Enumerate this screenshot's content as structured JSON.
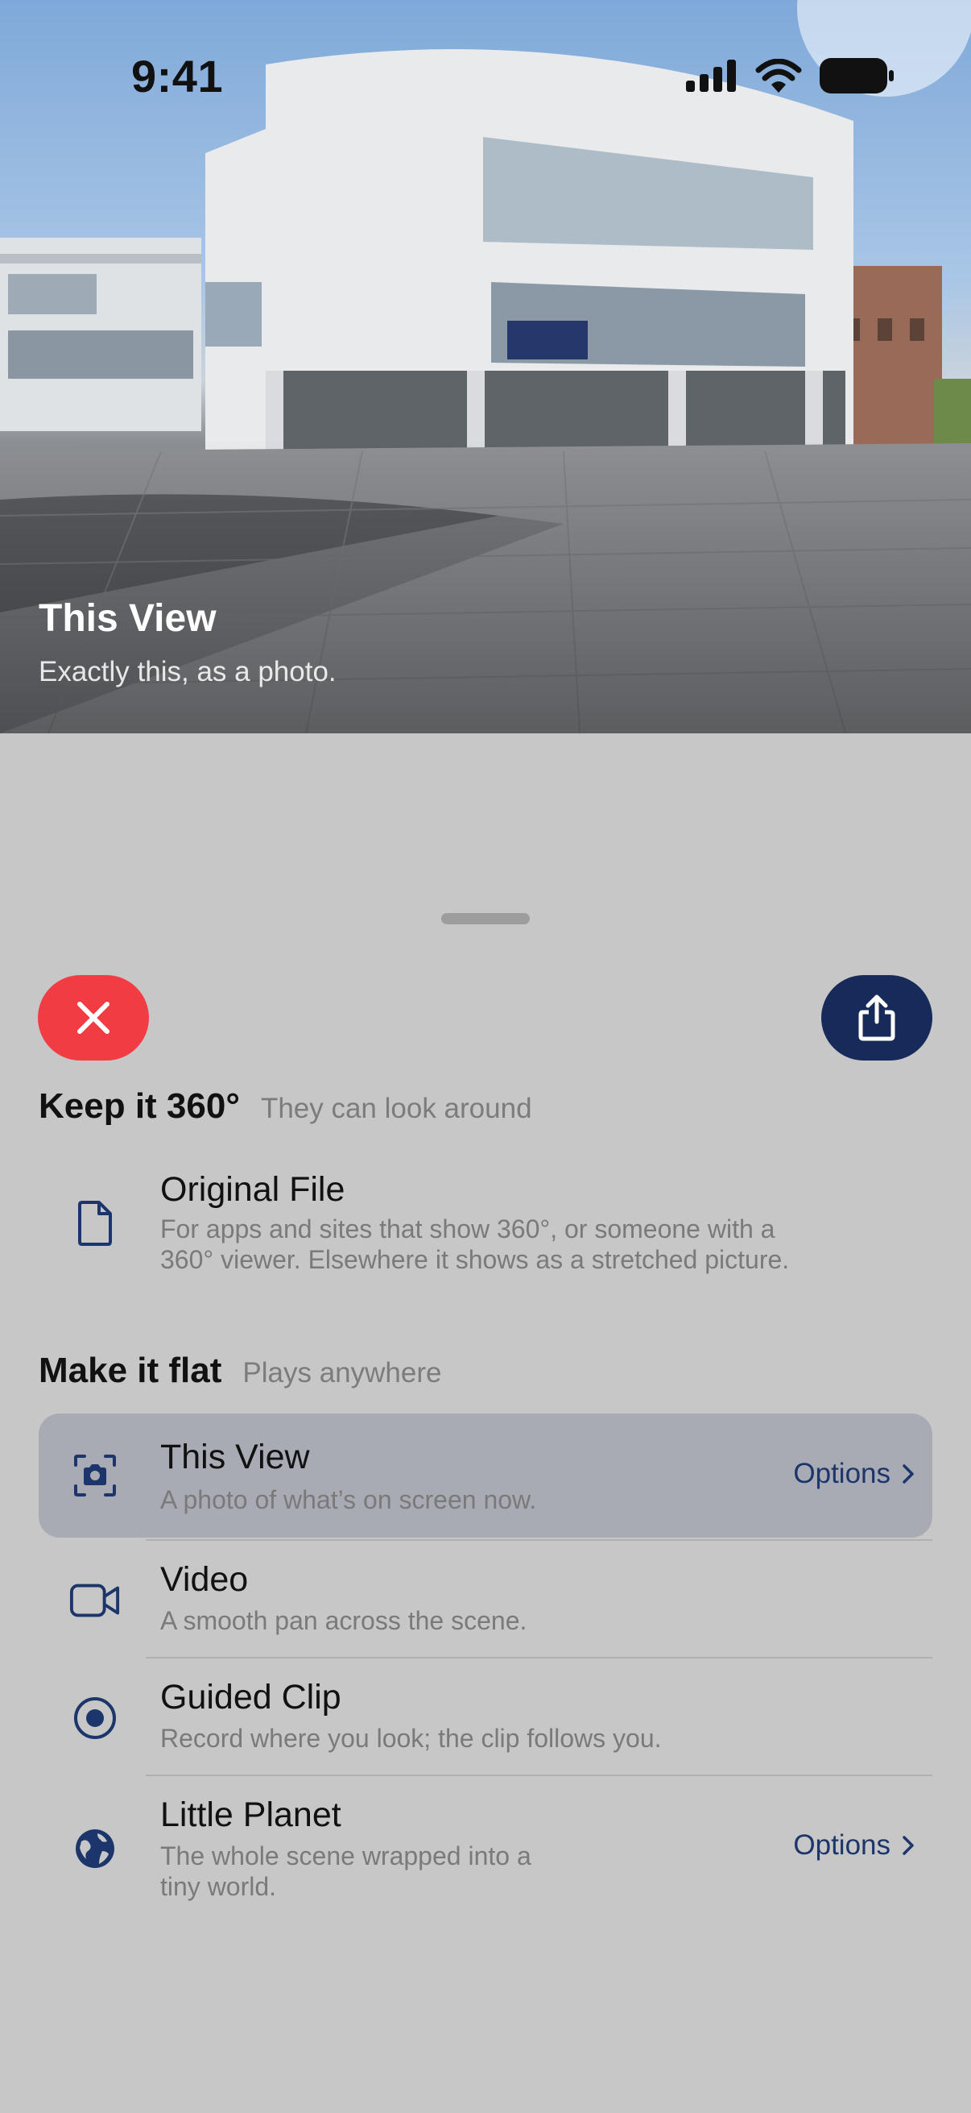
{
  "status_bar": {
    "time": "9:41",
    "icons": [
      "cellular-signal-icon",
      "wifi-icon",
      "battery-icon"
    ]
  },
  "hero": {
    "title": "This View",
    "subtitle": "Exactly this, as a photo."
  },
  "actions": {
    "close_icon": "close-icon",
    "share_icon": "share-icon"
  },
  "colors": {
    "close": "#f23c43",
    "share": "#162b5a",
    "accent": "#1c356a",
    "selected_row": "#a8abb4",
    "sheet": "#c7c7c7"
  },
  "keep_section": {
    "title": "Keep it 360°",
    "subtitle": "They can look around",
    "items": [
      {
        "icon": "document-icon",
        "title": "Original File",
        "desc_line1": "For apps and sites that show 360°, or someone with a",
        "desc_line2": "360° viewer. Elsewhere it shows as a stretched picture."
      }
    ]
  },
  "flat_section": {
    "title": "Make it flat",
    "subtitle": "Plays anywhere",
    "items": [
      {
        "icon": "camera-viewfinder-icon",
        "title": "This View",
        "desc_line1": "A photo of what’s on screen now.",
        "options": "Options",
        "selected": true
      },
      {
        "icon": "video-camera-icon",
        "title": "Video",
        "desc_line1": "A smooth pan across the scene."
      },
      {
        "icon": "record-circle-icon",
        "title": "Guided Clip",
        "desc_line1": "Record where you look; the clip follows you."
      },
      {
        "icon": "globe-icon",
        "title": "Little Planet",
        "desc_line1": "The whole scene wrapped into a",
        "desc_line2": "tiny world.",
        "options": "Options"
      }
    ]
  }
}
